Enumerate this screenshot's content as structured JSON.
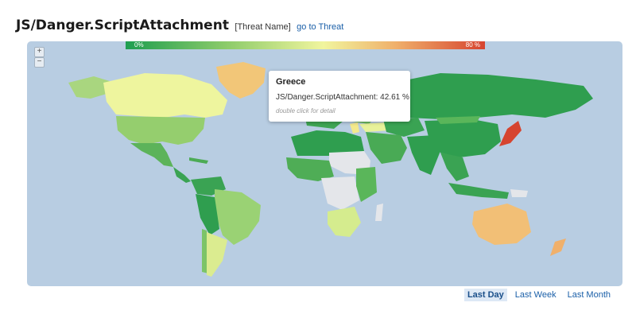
{
  "header": {
    "title": "JS/Danger.ScriptAttachment",
    "tag": "[Threat Name]",
    "link": "go to Threat"
  },
  "legend": {
    "min_label": "0%",
    "max_label": "80 %"
  },
  "zoom": {
    "in": "+",
    "out": "−"
  },
  "tooltip": {
    "country": "Greece",
    "value_text": "JS/Danger.ScriptAttachment: 42.61 %",
    "hint": "double click for detail"
  },
  "tabs": [
    {
      "label": "Last Day",
      "active": true
    },
    {
      "label": "Last Week",
      "active": false
    },
    {
      "label": "Last Month",
      "active": false
    }
  ],
  "colors": {
    "ocean": "#b8cde2",
    "no_data": "#e4e6ea",
    "scale_low": "#1e9e50",
    "scale_mid": "#f1f59e",
    "scale_high": "#d6442f"
  }
}
